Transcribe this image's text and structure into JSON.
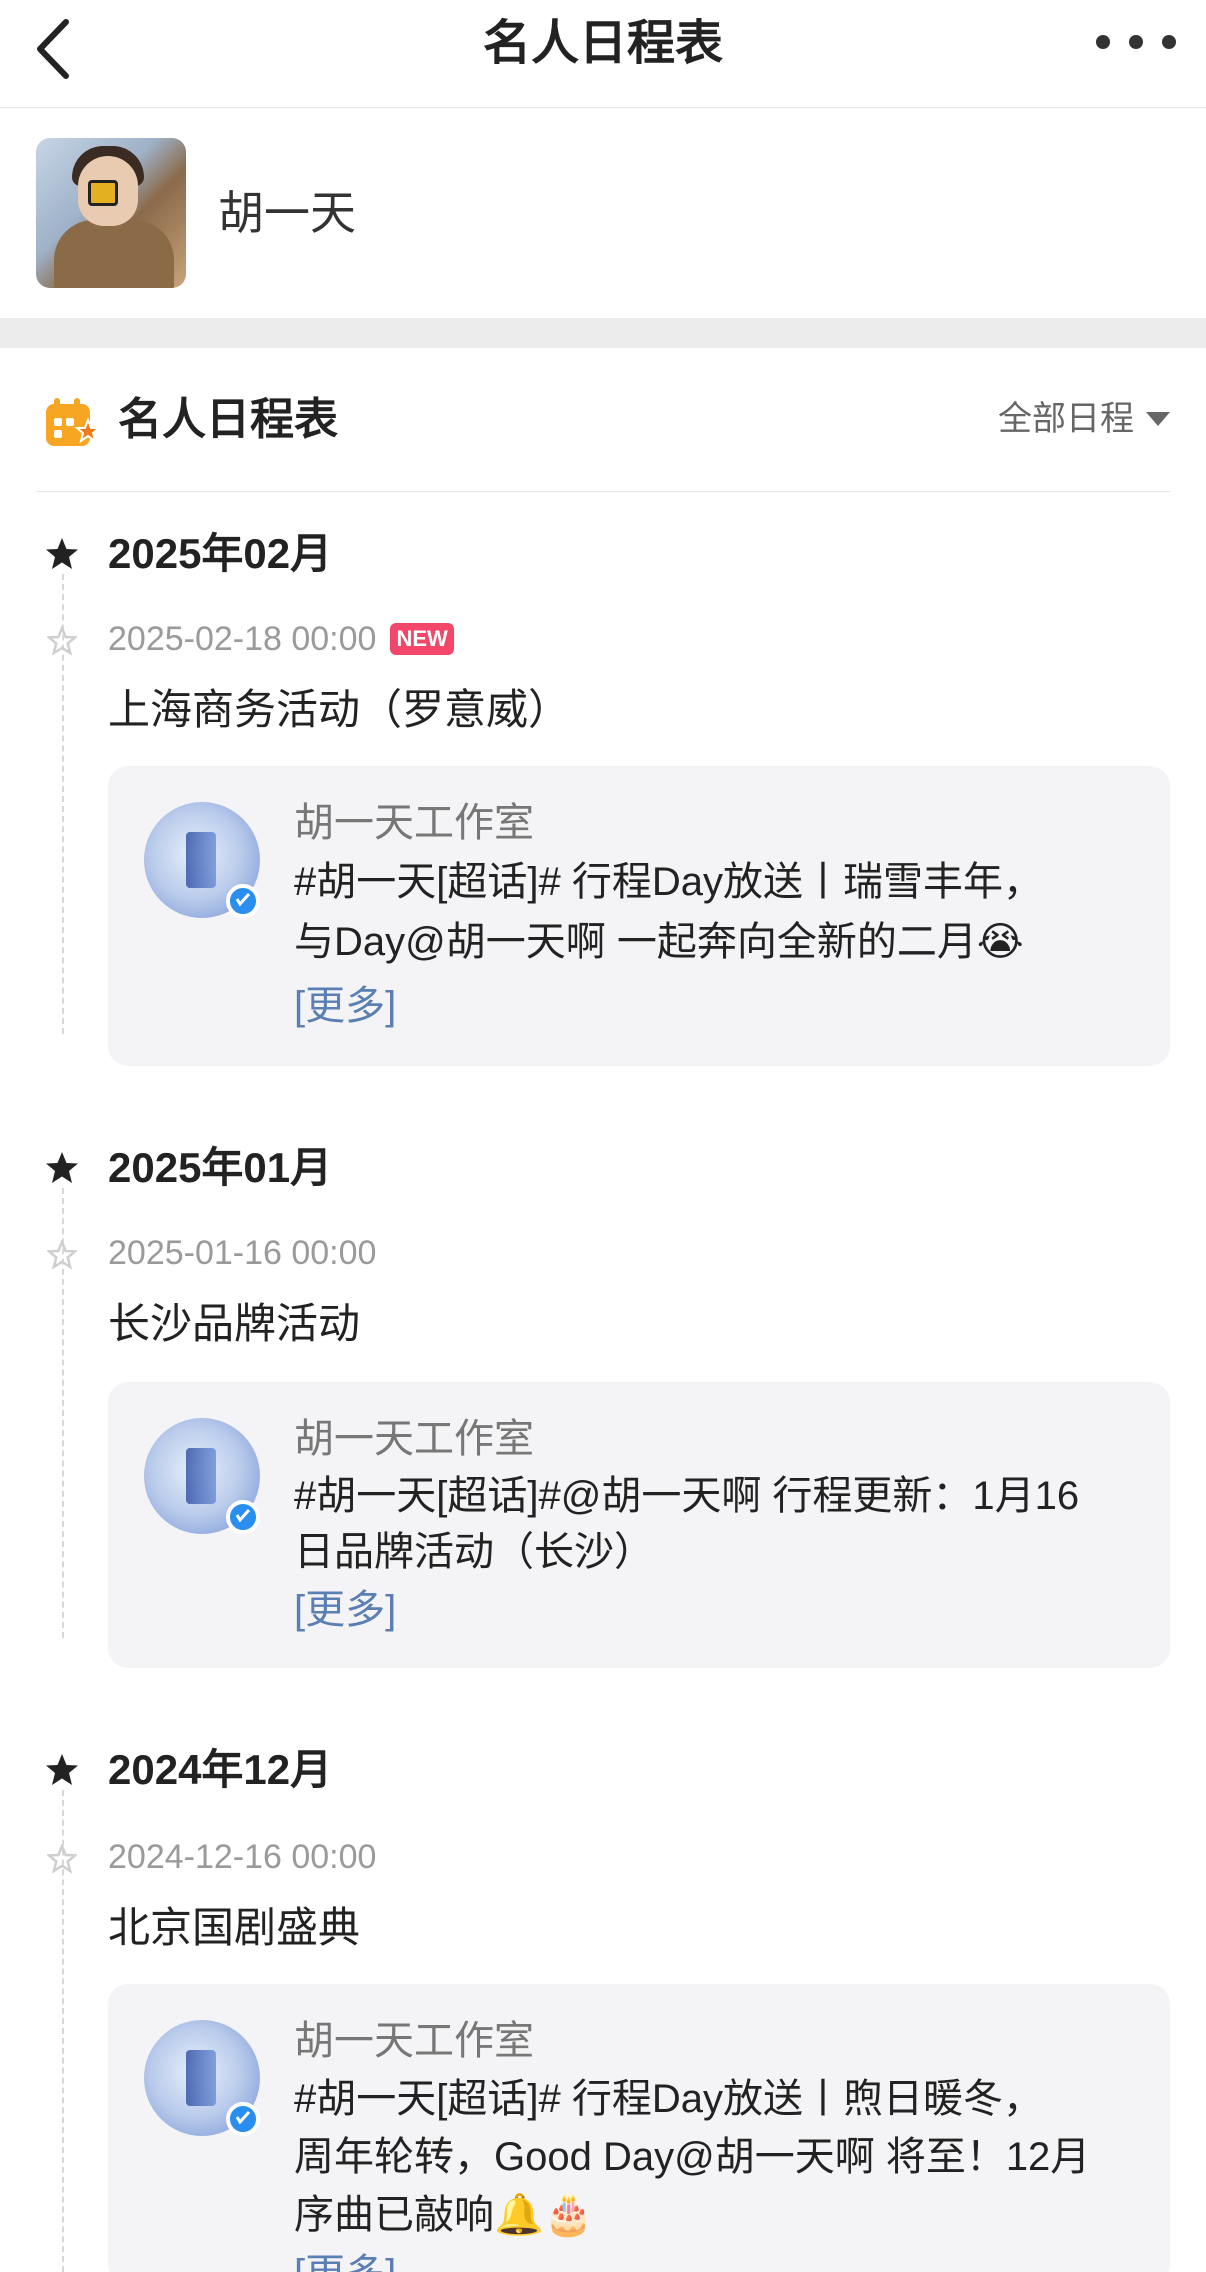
{
  "header": {
    "title": "名人日程表"
  },
  "profile": {
    "name": "胡一天"
  },
  "section": {
    "title": "名人日程表",
    "filter_label": "全部日程"
  },
  "groups": [
    {
      "month": "2025年02月",
      "date": "2025-02-18 00:00",
      "badge": "NEW",
      "event": "上海商务活动（罗意威）",
      "post": {
        "author": "胡一天工作室",
        "line1": "#胡一天[超话]# 行程Day放送丨瑞雪丰年，",
        "line2": "与Day@胡一天啊 一起奔向全新的二月😭",
        "more": "[更多]"
      }
    },
    {
      "month": "2025年01月",
      "date": "2025-01-16 00:00",
      "event": "长沙品牌活动",
      "post": {
        "author": "胡一天工作室",
        "line1": "#胡一天[超话]#@胡一天啊 行程更新：1月16",
        "line2": "日品牌活动（长沙）",
        "more": "[更多]"
      }
    },
    {
      "month": "2024年12月",
      "date": "2024-12-16 00:00",
      "event": "北京国剧盛典",
      "post": {
        "author": "胡一天工作室",
        "line1": "#胡一天[超话]# 行程Day放送丨煦日暖冬，",
        "line2": "周年轮转，Good Day@胡一天啊 将至！12月",
        "line3": "序曲已敲响🔔🎂",
        "more": "[更多]"
      }
    }
  ]
}
